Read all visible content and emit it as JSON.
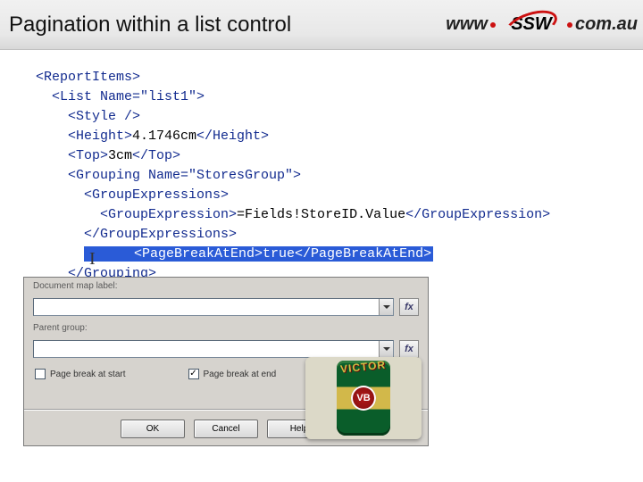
{
  "header": {
    "title": "Pagination within a list control",
    "logo": {
      "www": "www",
      "brand": "SSW",
      "tld": "com.au"
    }
  },
  "xml": {
    "l1": "<ReportItems>",
    "l2": "  <List Name=\"list1\">",
    "l3": "    <Style />",
    "l4_open": "    <Height>",
    "l4_val": "4.1746cm",
    "l4_close": "</Height>",
    "l5_open": "    <Top>",
    "l5_val": "3cm",
    "l5_close": "</Top>",
    "l6": "    <Grouping Name=\"StoresGroup\">",
    "l7": "      <GroupExpressions>",
    "l8_open": "        <GroupExpression>",
    "l8_val": "=Fields!StoreID.Value",
    "l8_close": "</GroupExpression>",
    "l9": "      </GroupExpressions>",
    "l10": "      <PageBreakAtEnd>true</PageBreakAtEnd>",
    "l11": "    </Grouping>"
  },
  "dialog": {
    "doc_map_label": "Document map label:",
    "doc_map_value": "",
    "parent_group_label": "Parent group:",
    "parent_group_value": "",
    "fx": "fx",
    "pb_start": "Page break at start",
    "pb_end": "Page break at end",
    "pb_start_checked": false,
    "pb_end_checked": true,
    "ok": "OK",
    "cancel": "Cancel",
    "help": "Help"
  },
  "photo": {
    "arc_text": "VICTOR",
    "can_text": "VB"
  }
}
